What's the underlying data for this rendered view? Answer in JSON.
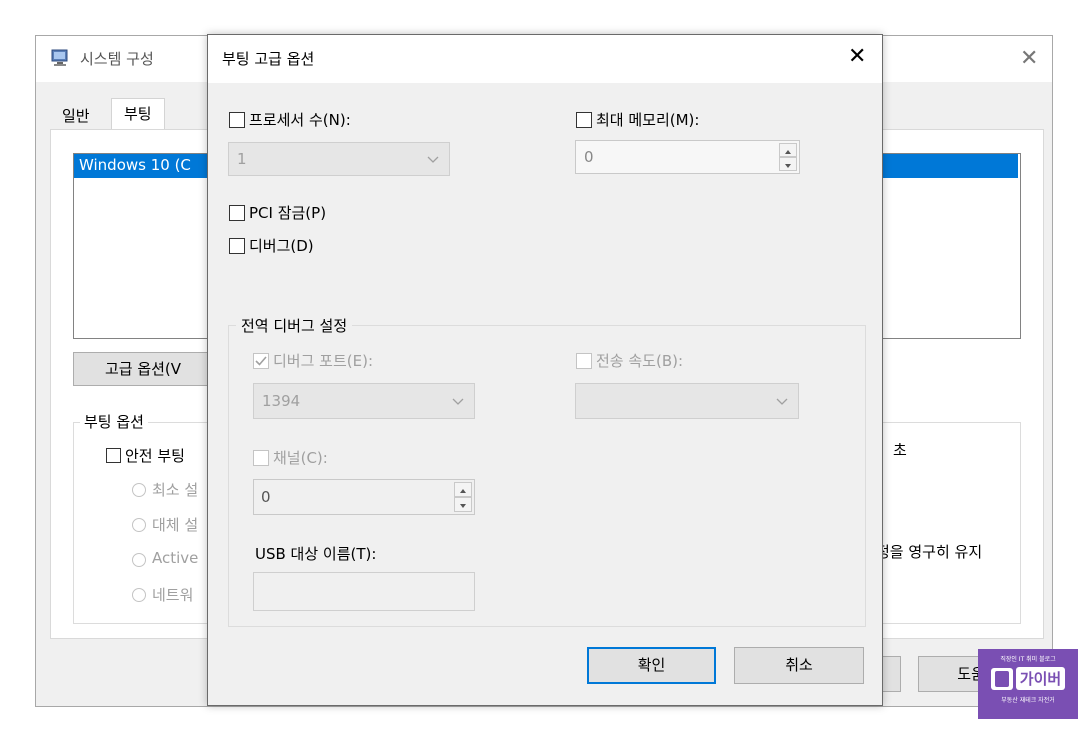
{
  "parent_window": {
    "title": "시스템 구성",
    "tabs": [
      "일반",
      "부팅"
    ],
    "os_list_item": "Windows 10 (C",
    "advanced_button": "고급 옵션(V",
    "boot_options_group": "부팅 옵션",
    "safe_boot": "안전 부팅",
    "radios": [
      "최소 설",
      "대체 설",
      "Active",
      "네트워"
    ],
    "right_fragment_seconds": "초",
    "right_fragment_persist": "정을 영구히 유지",
    "help_button": "도움말"
  },
  "dialog": {
    "title": "부팅 고급 옵션",
    "processors_label": "프로세서 수(N):",
    "processors_value": "1",
    "max_memory_label": "최대 메모리(M):",
    "max_memory_value": "0",
    "pci_lock_label": "PCI 잠금(P)",
    "debug_label": "디버그(D)",
    "global_debug_group": "전역 디버그 설정",
    "debug_port_label": "디버그 포트(E):",
    "debug_port_value": "1394",
    "baud_rate_label": "전송 속도(B):",
    "baud_rate_value": "",
    "channel_label": "채널(C):",
    "channel_value": "0",
    "usb_target_label": "USB 대상 이름(T):",
    "usb_target_value": "",
    "ok_button": "확인",
    "cancel_button": "취소"
  },
  "watermark": {
    "top_line": "직장인 IT 취미 블로그",
    "logo_text": "가이버",
    "bottom_line": "부동산 재테크 자전거"
  },
  "colors": {
    "selection_blue": "#0078d7",
    "ok_border": "#0078d7",
    "logo_purple": "#7a4fb3"
  }
}
